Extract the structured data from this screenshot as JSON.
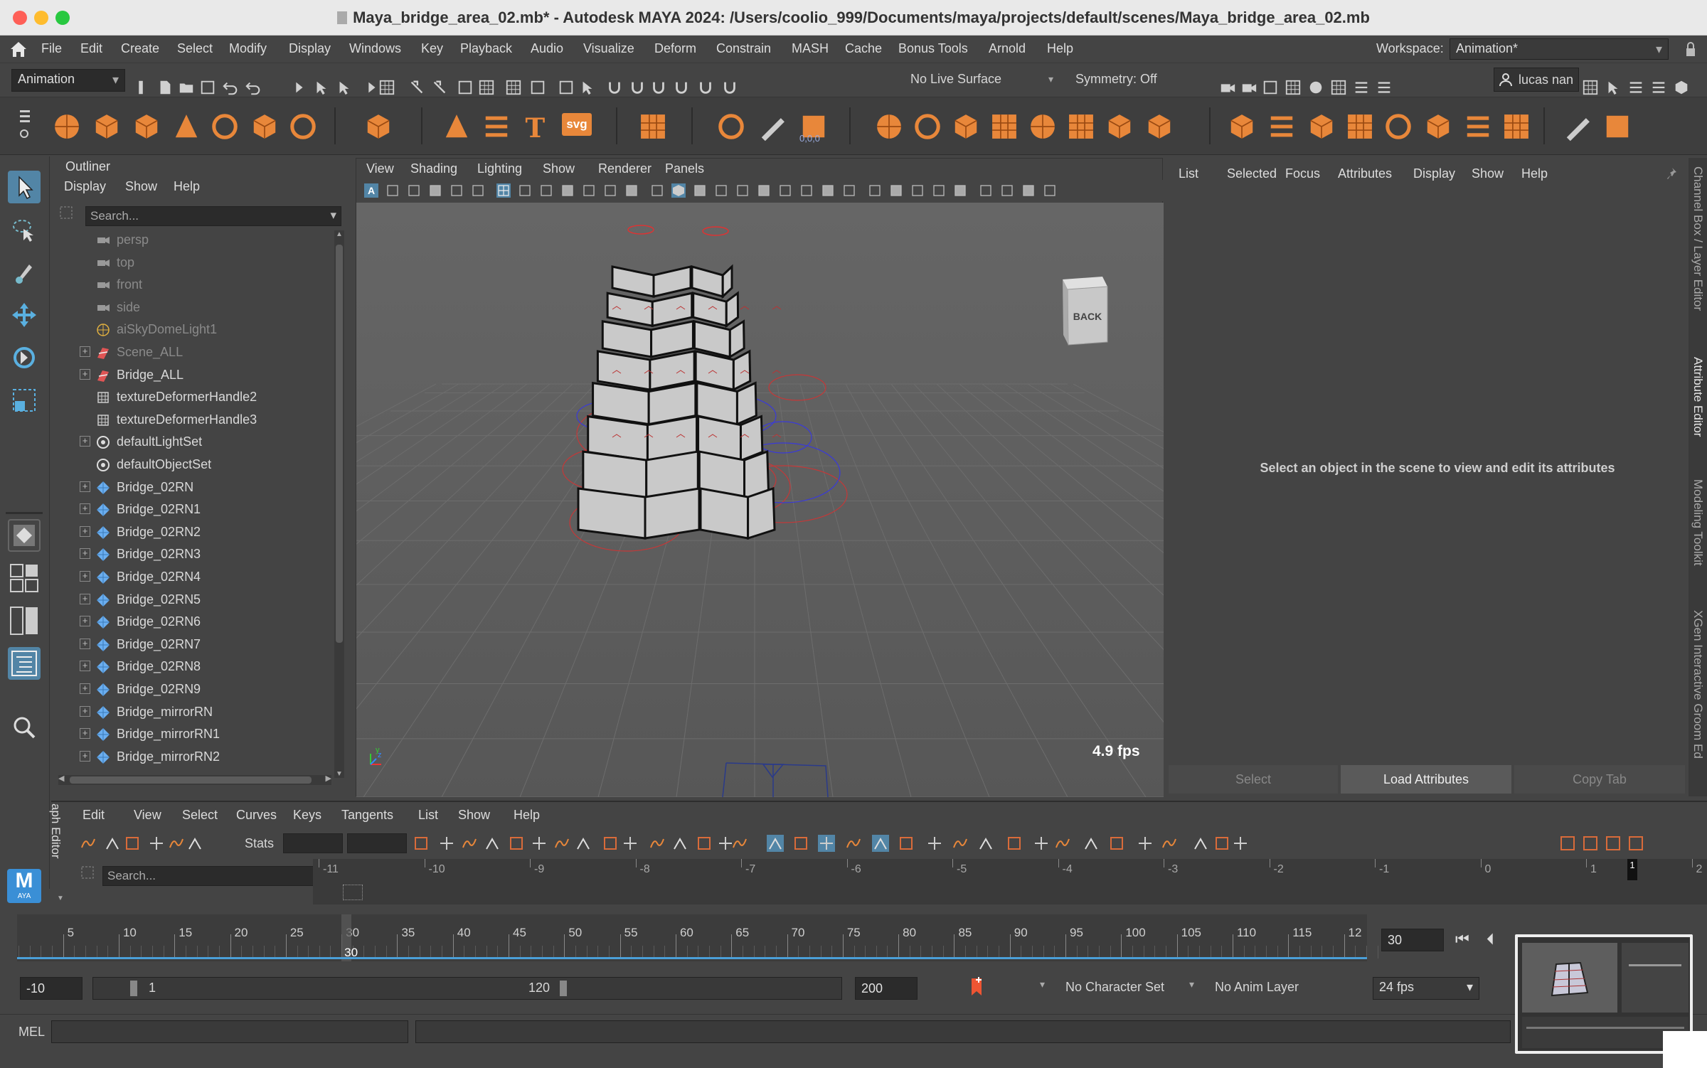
{
  "window": {
    "title": "Maya_bridge_area_02.mb* - Autodesk MAYA 2024: /Users/coolio_999/Documents/maya/projects/default/scenes/Maya_bridge_area_02.mb"
  },
  "menubar": {
    "items": [
      "File",
      "Edit",
      "Create",
      "Select",
      "Modify",
      "Display",
      "Windows",
      "Key",
      "Playback",
      "Audio",
      "Visualize",
      "Deform",
      "Constrain",
      "MASH",
      "Cache",
      "Bonus Tools",
      "Arnold",
      "Help"
    ],
    "workspace_label": "Workspace:",
    "workspace_value": "Animation*"
  },
  "statusline": {
    "mode": "Animation",
    "live_surface": "No Live Surface",
    "symmetry": "Symmetry: Off",
    "user": "lucas nan"
  },
  "shelf": {
    "svg_label": "svg",
    "coord_label": "0,0,0"
  },
  "toolbox": {
    "logo": "M",
    "logo_sub": "AYA"
  },
  "outliner": {
    "title": "Outliner",
    "menus": [
      "Display",
      "Show",
      "Help"
    ],
    "search_placeholder": "Search...",
    "items": [
      {
        "label": "persp",
        "icon": "camera-icon",
        "dim": true,
        "expand": false
      },
      {
        "label": "top",
        "icon": "camera-icon",
        "dim": true,
        "expand": false
      },
      {
        "label": "front",
        "icon": "camera-icon",
        "dim": true,
        "expand": false
      },
      {
        "label": "side",
        "icon": "camera-icon",
        "dim": true,
        "expand": false
      },
      {
        "label": "aiSkyDomeLight1",
        "icon": "skydome-icon",
        "dim": true,
        "expand": false
      },
      {
        "label": "Scene_ALL",
        "icon": "group-icon",
        "dim": true,
        "expand": true
      },
      {
        "label": "Bridge_ALL",
        "icon": "group-icon",
        "dim": false,
        "expand": true
      },
      {
        "label": "textureDeformerHandle2",
        "icon": "deformer-icon",
        "dim": false,
        "expand": false
      },
      {
        "label": "textureDeformerHandle3",
        "icon": "deformer-icon",
        "dim": false,
        "expand": false
      },
      {
        "label": "defaultLightSet",
        "icon": "set-icon",
        "dim": false,
        "expand": true
      },
      {
        "label": "defaultObjectSet",
        "icon": "set-icon",
        "dim": false,
        "expand": false
      },
      {
        "label": "Bridge_02RN",
        "icon": "reference-icon",
        "dim": false,
        "expand": true
      },
      {
        "label": "Bridge_02RN1",
        "icon": "reference-icon",
        "dim": false,
        "expand": true
      },
      {
        "label": "Bridge_02RN2",
        "icon": "reference-icon",
        "dim": false,
        "expand": true
      },
      {
        "label": "Bridge_02RN3",
        "icon": "reference-icon",
        "dim": false,
        "expand": true
      },
      {
        "label": "Bridge_02RN4",
        "icon": "reference-icon",
        "dim": false,
        "expand": true
      },
      {
        "label": "Bridge_02RN5",
        "icon": "reference-icon",
        "dim": false,
        "expand": true
      },
      {
        "label": "Bridge_02RN6",
        "icon": "reference-icon",
        "dim": false,
        "expand": true
      },
      {
        "label": "Bridge_02RN7",
        "icon": "reference-icon",
        "dim": false,
        "expand": true
      },
      {
        "label": "Bridge_02RN8",
        "icon": "reference-icon",
        "dim": false,
        "expand": true
      },
      {
        "label": "Bridge_02RN9",
        "icon": "reference-icon",
        "dim": false,
        "expand": true
      },
      {
        "label": "Bridge_mirrorRN",
        "icon": "reference-icon",
        "dim": false,
        "expand": true
      },
      {
        "label": "Bridge_mirrorRN1",
        "icon": "reference-icon",
        "dim": false,
        "expand": true
      },
      {
        "label": "Bridge_mirrorRN2",
        "icon": "reference-icon",
        "dim": false,
        "expand": true
      }
    ]
  },
  "viewport": {
    "menus": [
      "View",
      "Shading",
      "Lighting",
      "Show",
      "Renderer",
      "Panels"
    ],
    "viewcube_label": "BACK",
    "fps": "4.9 fps"
  },
  "attribute_editor": {
    "menus": [
      "List",
      "Selected",
      "Focus",
      "Attributes",
      "Display",
      "Show",
      "Help"
    ],
    "message": "Select an object in the scene to view and edit its attributes",
    "buttons": [
      "Select",
      "Load Attributes",
      "Copy Tab"
    ]
  },
  "side_tabs": [
    "Channel Box / Layer Editor",
    "Attribute Editor",
    "Modeling Toolkit",
    "XGen Interactive Groom Ed"
  ],
  "graph_editor": {
    "menus": [
      "Edit",
      "View",
      "Select",
      "Curves",
      "Keys",
      "Tangents",
      "List",
      "Show",
      "Help"
    ],
    "stats_label": "Stats",
    "search_placeholder": "Search...",
    "side_label": "aph Editor",
    "ruler": [
      "-11",
      "-10",
      "-9",
      "-8",
      "-7",
      "-6",
      "-5",
      "-4",
      "-3",
      "-2",
      "-1",
      "0",
      "1",
      "2"
    ],
    "current_frame_marker": "1"
  },
  "timeline": {
    "ticks": [
      "5",
      "10",
      "15",
      "20",
      "25",
      "30",
      "35",
      "40",
      "45",
      "50",
      "55",
      "60",
      "65",
      "70",
      "75",
      "80",
      "85",
      "90",
      "95",
      "100",
      "105",
      "110",
      "115",
      "12"
    ],
    "current_frame": "30",
    "frame_field": "30"
  },
  "range": {
    "start": "-10",
    "inner_start": "1",
    "inner_end": "120",
    "end": "200",
    "character_set": "No Character Set",
    "anim_layer": "No Anim Layer",
    "fps": "24 fps"
  },
  "command_line": {
    "label": "MEL"
  },
  "colors": {
    "accent": "#5285a6",
    "orange_shelf": "#e8873a",
    "selected": "#4a6f8a"
  }
}
